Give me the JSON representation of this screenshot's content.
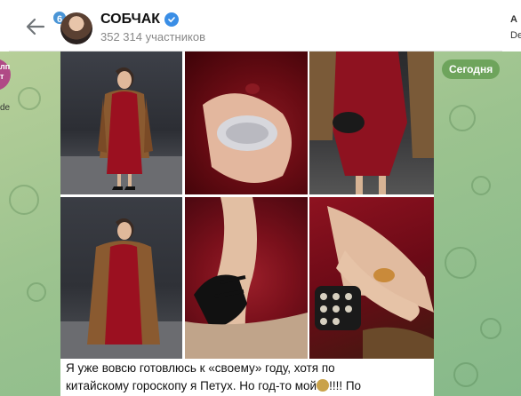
{
  "header": {
    "unread_count": "6",
    "title": "СОБЧАК",
    "subscribers": "352 314 участников"
  },
  "right_panel": {
    "line1": "A",
    "line2": "De"
  },
  "left_strip": {
    "label": "de"
  },
  "date_pill": "Сегодня",
  "message": {
    "caption_line1": "Я уже вовсю готовлюсь к «своему» году, хотя по",
    "caption_line2": "китайскому гороскопу я Петух. Но год-то мой",
    "caption_line2_tail": "!!!! По"
  },
  "colors": {
    "accent": "#4a95d6",
    "date_pill": "#6ea45c",
    "verified": "#3a8ee6"
  },
  "icons": [
    "back-arrow-icon",
    "verified-icon"
  ]
}
